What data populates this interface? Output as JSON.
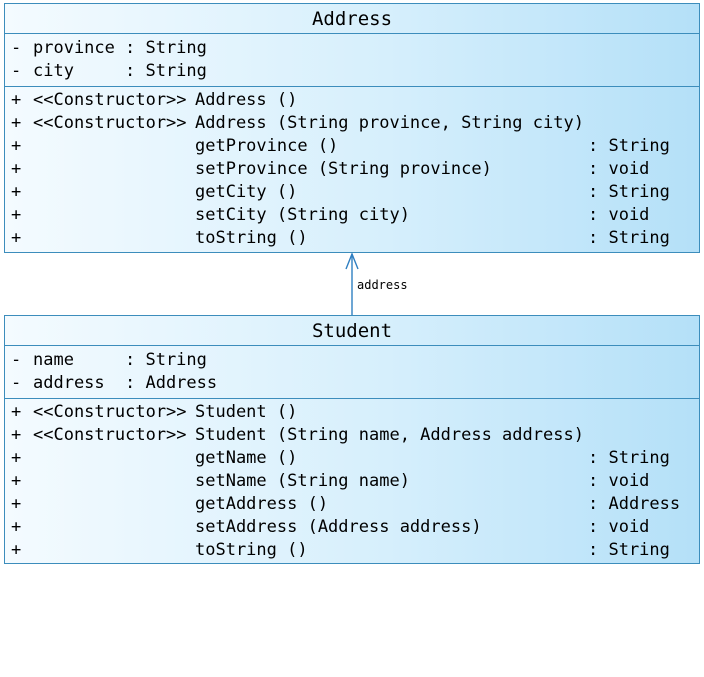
{
  "classes": [
    {
      "name": "Address",
      "attributes": [
        {
          "vis": "-",
          "name": "province",
          "type": ": String"
        },
        {
          "vis": "-",
          "name": "city",
          "type": ": String"
        }
      ],
      "operations": [
        {
          "vis": "+",
          "stereo": "<<Constructor>>",
          "sig": "Address ()",
          "type": ""
        },
        {
          "vis": "+",
          "stereo": "<<Constructor>>",
          "sig": "Address (String province, String city)",
          "type": ""
        },
        {
          "vis": "+",
          "stereo": "",
          "sig": "getProvince ()",
          "type": ": String"
        },
        {
          "vis": "+",
          "stereo": "",
          "sig": "setProvince (String province)",
          "type": ": void"
        },
        {
          "vis": "+",
          "stereo": "",
          "sig": "getCity ()",
          "type": ": String"
        },
        {
          "vis": "+",
          "stereo": "",
          "sig": "setCity (String city)",
          "type": ": void"
        },
        {
          "vis": "+",
          "stereo": "",
          "sig": "toString ()",
          "type": ": String"
        }
      ]
    },
    {
      "name": "Student",
      "attributes": [
        {
          "vis": "-",
          "name": "name",
          "type": ": String"
        },
        {
          "vis": "-",
          "name": "address",
          "type": ": Address"
        }
      ],
      "operations": [
        {
          "vis": "+",
          "stereo": "<<Constructor>>",
          "sig": "Student ()",
          "type": ""
        },
        {
          "vis": "+",
          "stereo": "<<Constructor>>",
          "sig": "Student (String name, Address address)",
          "type": ""
        },
        {
          "vis": "+",
          "stereo": "",
          "sig": "getName ()",
          "type": ": String"
        },
        {
          "vis": "+",
          "stereo": "",
          "sig": "setName (String name)",
          "type": ": void"
        },
        {
          "vis": "+",
          "stereo": "",
          "sig": "getAddress ()",
          "type": ": Address"
        },
        {
          "vis": "+",
          "stereo": "",
          "sig": "setAddress (Address address)",
          "type": ": void"
        },
        {
          "vis": "+",
          "stereo": "",
          "sig": "toString ()",
          "type": ": String"
        }
      ]
    }
  ],
  "association": {
    "label": "address"
  },
  "colors": {
    "border": "#3c8dbc",
    "fill_light": "#f4fbff",
    "fill_dark": "#b4e0f8",
    "line": "#2f7fc1"
  }
}
